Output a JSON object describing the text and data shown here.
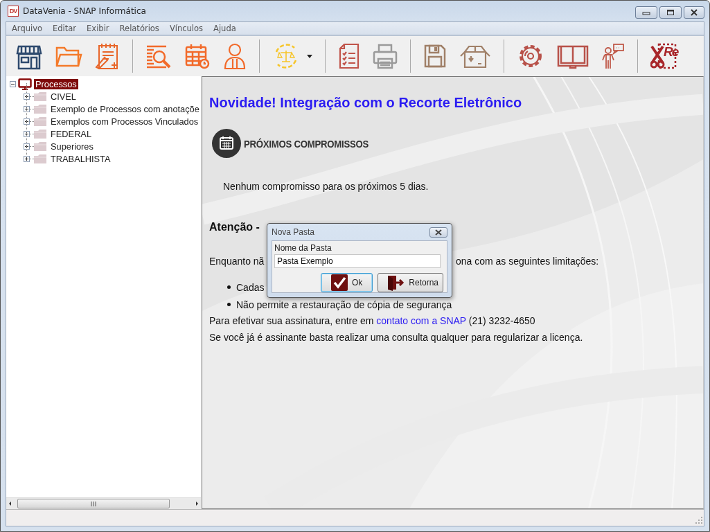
{
  "window": {
    "title": "DataVenia - SNAP Informática",
    "logo_text": "DV"
  },
  "menu": [
    "Arquivo",
    "Editar",
    "Exibir",
    "Relatórios",
    "Vínculos",
    "Ajuda"
  ],
  "toolbar": {
    "recorte_icon_text": "Re"
  },
  "tree": {
    "label": "Processos",
    "selected": true,
    "expanded": true,
    "children": [
      {
        "label": "CIVEL",
        "selected": false,
        "expanded": false
      },
      {
        "label": "Exemplo de Processos com anotaçõe",
        "selected": false,
        "expanded": false
      },
      {
        "label": "Exemplos com Processos Vinculados",
        "selected": false,
        "expanded": false
      },
      {
        "label": "FEDERAL",
        "selected": false,
        "expanded": false
      },
      {
        "label": "Superiores",
        "selected": false,
        "expanded": false
      },
      {
        "label": "TRABALHISTA",
        "selected": false,
        "expanded": false
      }
    ]
  },
  "content": {
    "headline": "Novidade! Integração com o Recorte Eletrônico",
    "section_title": "PRÓXIMOS COMPROMISSOS",
    "no_events": "Nenhum compromisso para os próximos 5 dias.",
    "attention_title": "Atenção -",
    "limits_left": "Enquanto nã",
    "limits_right": "ona com as seguintes limitações:",
    "bullets": [
      "Cadas",
      "Não permite a restauração de cópia de segurança"
    ],
    "subscribe": {
      "before": "Para efetivar sua assinatura, entre em ",
      "link": "contato com a SNAP",
      "after": " (21) 3232-4650"
    },
    "license_note": "Se você já é assinante basta realizar uma consulta qualquer para regularizar a licença."
  },
  "dialog": {
    "title": "Nova Pasta",
    "field_label": "Nome da Pasta",
    "field_value": "Pasta Exemplo",
    "buttons": [
      {
        "label": "Ok",
        "kind": "ok",
        "focused": true
      },
      {
        "label": "Retorna",
        "kind": "back",
        "focused": false
      }
    ]
  }
}
